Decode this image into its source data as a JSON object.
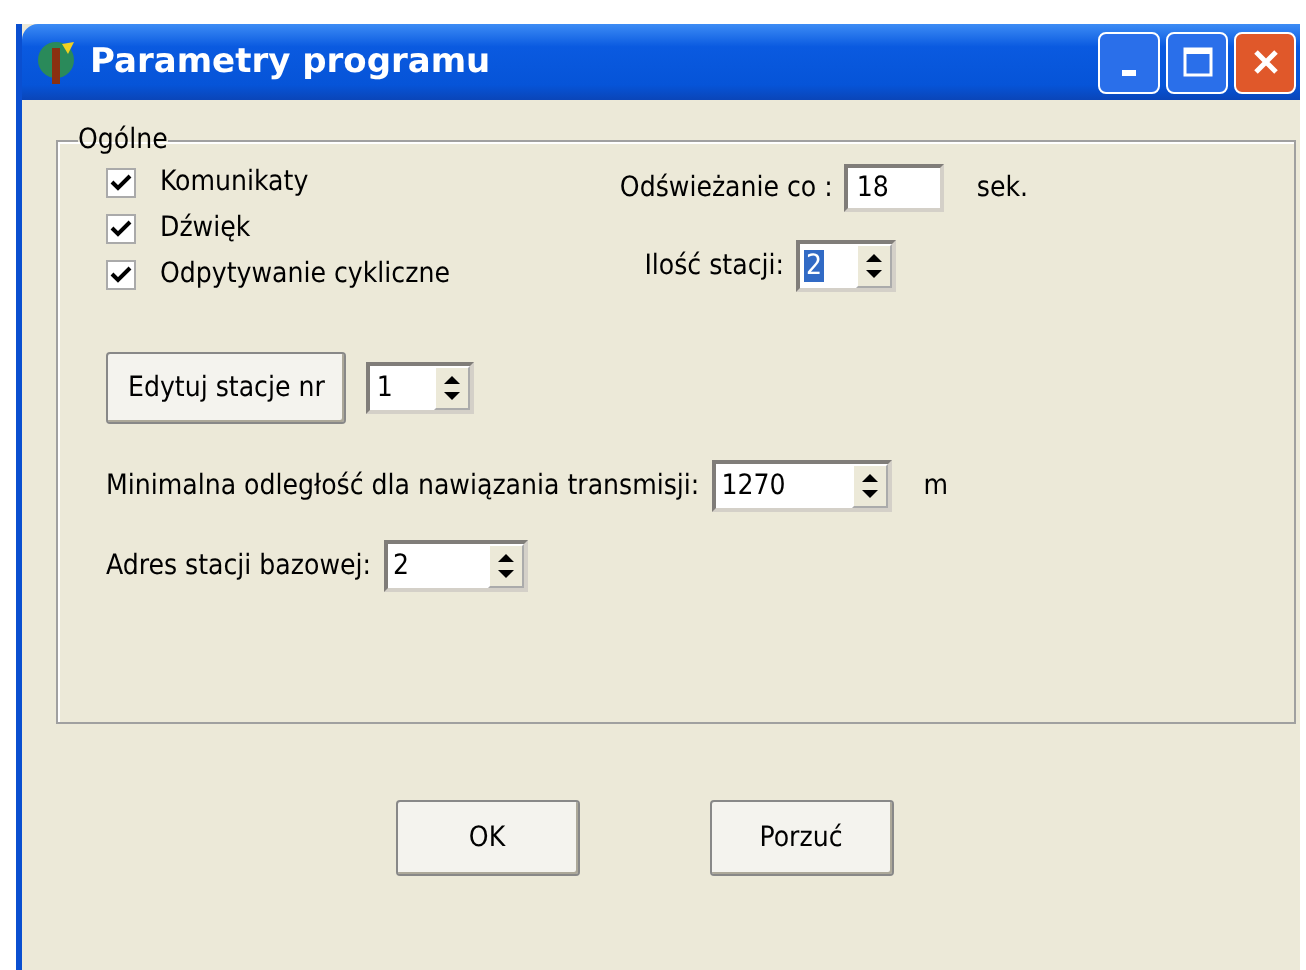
{
  "window": {
    "title": "Parametry programu"
  },
  "group": {
    "title": "Ogólne"
  },
  "checkboxes": [
    {
      "label": "Komunikaty",
      "checked": true
    },
    {
      "label": "Dźwięk",
      "checked": true
    },
    {
      "label": "Odpytywanie cykliczne",
      "checked": true
    }
  ],
  "refresh": {
    "label": "Odświeżanie co :",
    "value": "18",
    "unit": "sek."
  },
  "station_count": {
    "label": "Ilość stacji:",
    "value": "2",
    "value_selected": true
  },
  "edit_station": {
    "button": "Edytuj stacje nr",
    "value": "1"
  },
  "min_distance": {
    "label": "Minimalna odległość dla nawiązania transmisji:",
    "value": "1270",
    "unit": "m"
  },
  "base_address": {
    "label": "Adres stacji bazowej:",
    "value": "2"
  },
  "buttons": [
    "OK",
    "Porzuć"
  ]
}
